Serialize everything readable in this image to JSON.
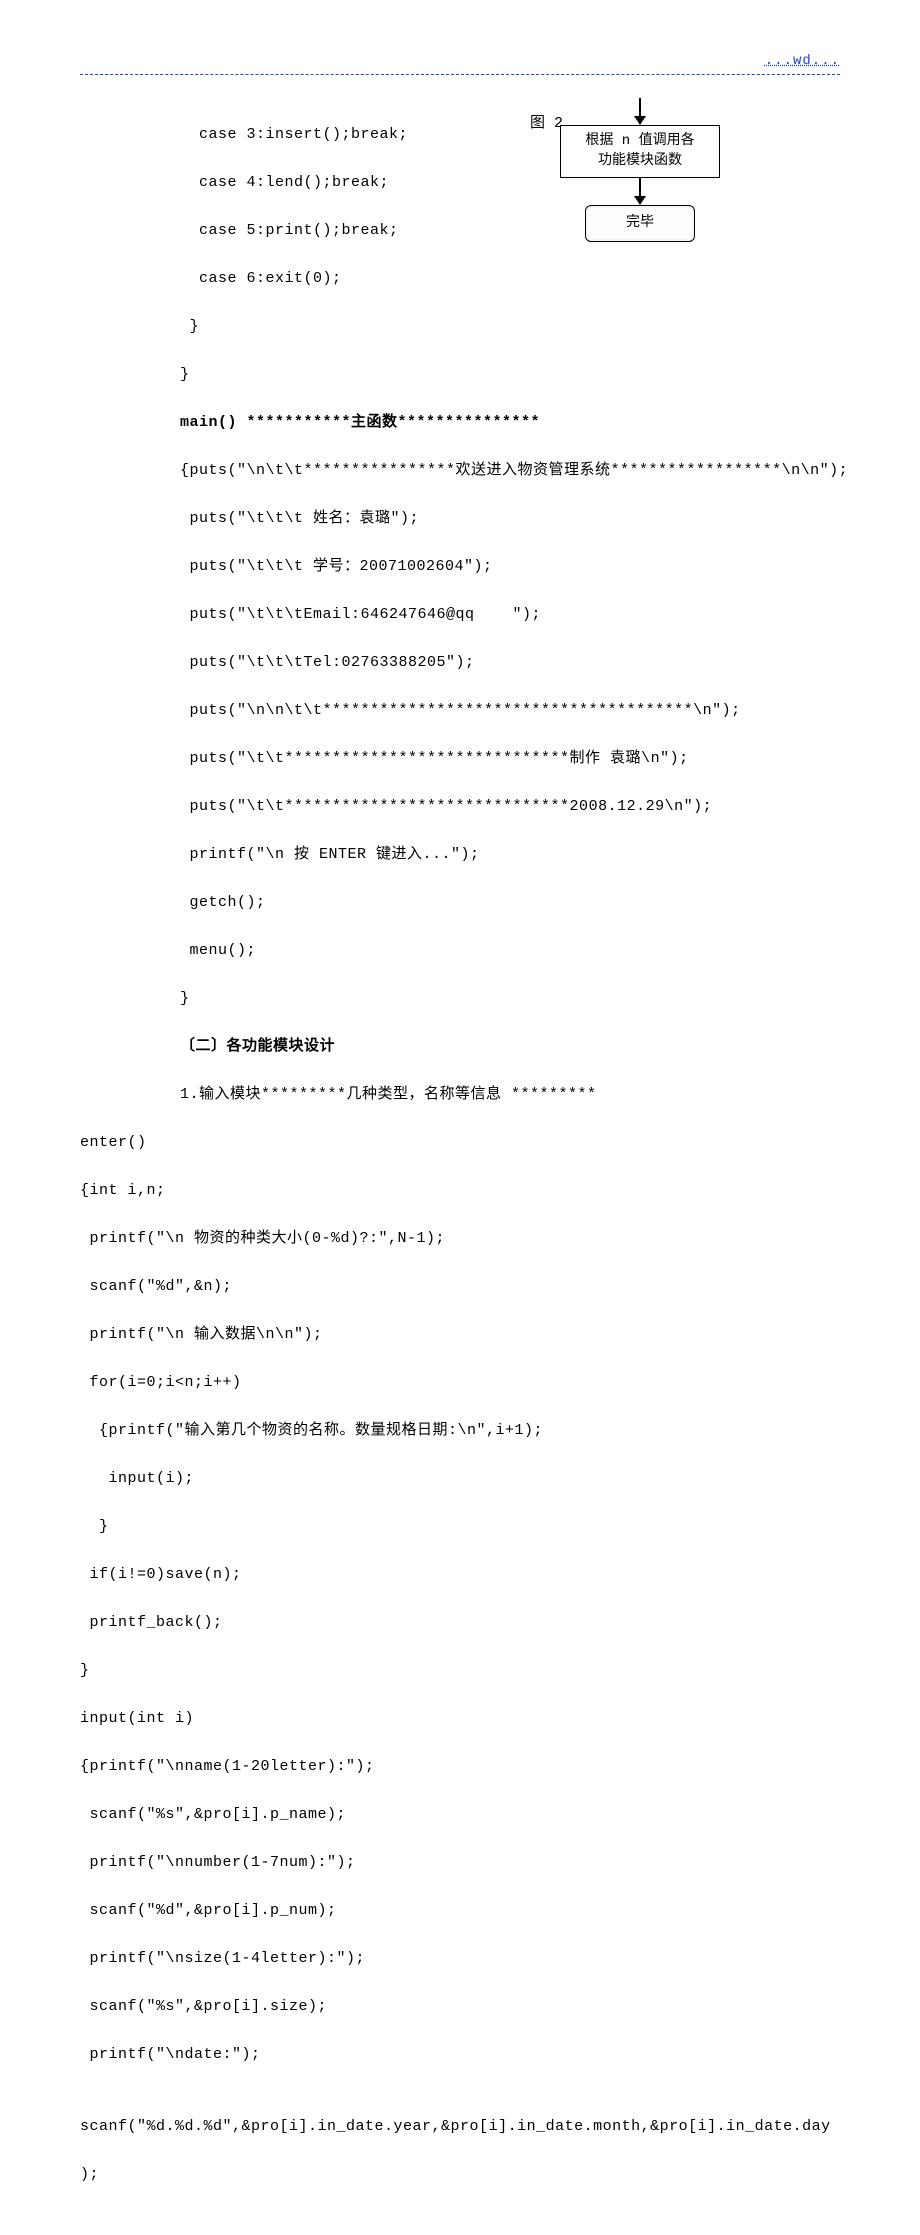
{
  "header": "...wd...",
  "fig_label": "图 2",
  "diagram": {
    "box1_line1": "根据 n 值调用各",
    "box1_line2": "功能模块函数",
    "box2": "完毕"
  },
  "code": {
    "l01": "  case 3:insert();break;",
    "l02": "  case 4:lend();break;",
    "l03": "  case 5:print();break;",
    "l04": "  case 6:exit(0);",
    "l05": " }",
    "l06": "}",
    "l07": "main() ***********主函数***************",
    "l08": "{puts(\"\\n\\t\\t****************欢送进入物资管理系统******************\\n\\n\");",
    "l09": " puts(\"\\t\\t\\t 姓名：袁璐\");",
    "l10": " puts(\"\\t\\t\\t 学号：20071002604\");",
    "l11": " puts(\"\\t\\t\\tEmail:646247646@qq    \");",
    "l12": " puts(\"\\t\\t\\tTel:02763388205\");",
    "l13": " puts(\"\\n\\n\\t\\t***************************************\\n\");",
    "l14": " puts(\"\\t\\t******************************制作 袁璐\\n\");",
    "l15": " puts(\"\\t\\t******************************2008.12.29\\n\");",
    "l16": " printf(\"\\n 按 ENTER 键进入...\");",
    "l17": " getch();",
    "l18": " menu();",
    "l19": "}",
    "l20": "〔二〕各功能模块设计",
    "l21": "1.输入模块*********几种类型，名称等信息 *********",
    "e01": "enter()",
    "e02": "{int i,n;",
    "e03": " printf(\"\\n 物资的种类大小(0-%d)?:\",N-1);",
    "e04": " scanf(\"%d\",&n);",
    "e05": " printf(\"\\n 输入数据\\n\\n\");",
    "e06": " for(i=0;i<n;i++)",
    "e07": "  {printf(\"输入第几个物资的名称。数量规格日期:\\n\",i+1);",
    "e08": "   input(i);",
    "e09": "  }",
    "e10": " if(i!=0)save(n);",
    "e11": " printf_back();",
    "e12": "}",
    "e13": "input(int i)",
    "e14": "{printf(\"\\nname(1-20letter):\");",
    "e15": " scanf(\"%s\",&pro[i].p_name);",
    "e16": " printf(\"\\nnumber(1-7num):\");",
    "e17": " scanf(\"%d\",&pro[i].p_num);",
    "e18": " printf(\"\\nsize(1-4letter):\");",
    "e19": " scanf(\"%s\",&pro[i].size);",
    "e20": " printf(\"\\ndate:\");",
    "e21": "",
    "e22": "scanf(\"%d.%d.%d\",&pro[i].in_date.year,&pro[i].in_date.month,&pro[i].in_date.day",
    "e23": ");"
  }
}
